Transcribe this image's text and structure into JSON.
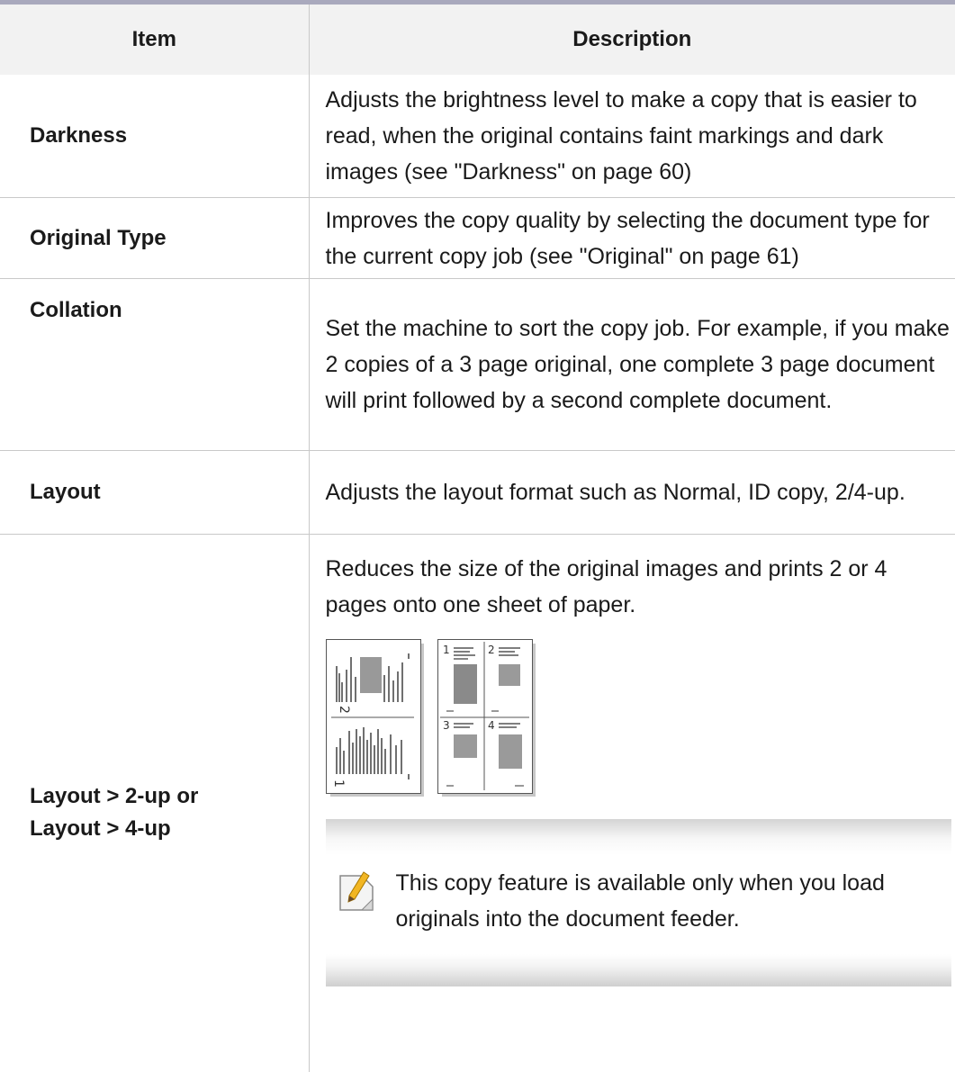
{
  "table": {
    "headers": {
      "item": "Item",
      "description": "Description"
    },
    "rows": [
      {
        "item": "Darkness",
        "description": "Adjusts the brightness level to make a copy that is easier to read, when the original contains faint markings and dark images (see \"Darkness\" on page 60)"
      },
      {
        "item": "Original Type",
        "description": "Improves the copy quality by selecting the document type for the current copy job (see \"Original\" on page 61)"
      },
      {
        "item": "Collation",
        "description": "Set the machine to sort the copy job. For example, if you make 2 copies of a 3 page original, one complete 3 page document will print followed by a second complete document."
      },
      {
        "item": "Layout",
        "description": "Adjusts the layout format such as Normal, ID copy, 2/4-up."
      },
      {
        "item_line1": "Layout > 2-up or",
        "item_line2": "Layout > 4-up",
        "description": "Reduces the size of the original images and prints 2 or 4 pages onto one sheet of paper."
      }
    ]
  },
  "figures": {
    "two_up_label": "2",
    "two_up_label_2": "1",
    "four_up_labels": [
      "1",
      "2",
      "3",
      "4"
    ]
  },
  "note": {
    "icon": "note-pencil-icon",
    "text": "This copy feature is available only when you load originals into the document feeder."
  }
}
